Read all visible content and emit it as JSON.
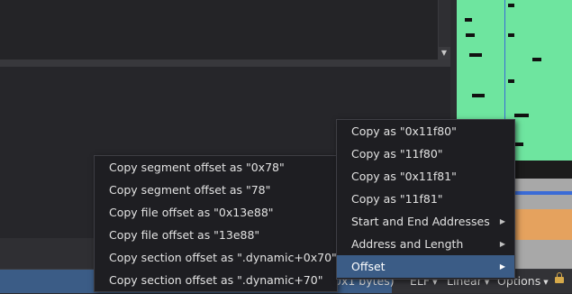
{
  "status": {
    "selection_text": "0x1 bytes)",
    "elf_label": "ELF",
    "linear_label": "Linear",
    "options_label": "Options"
  },
  "menu_main": {
    "items": [
      {
        "label": "Copy as \"0x11f80\"",
        "submenu": false,
        "active": false
      },
      {
        "label": "Copy as \"11f80\"",
        "submenu": false,
        "active": false
      },
      {
        "label": "Copy as \"0x11f81\"",
        "submenu": false,
        "active": false
      },
      {
        "label": "Copy as \"11f81\"",
        "submenu": false,
        "active": false
      },
      {
        "label": "Start and End Addresses",
        "submenu": true,
        "active": false
      },
      {
        "label": "Address and Length",
        "submenu": true,
        "active": false
      },
      {
        "label": "Offset",
        "submenu": true,
        "active": true
      }
    ]
  },
  "menu_offset": {
    "items": [
      {
        "label": "Copy segment offset as \"0x78\""
      },
      {
        "label": "Copy segment offset as \"78\""
      },
      {
        "label": "Copy file offset as \"0x13e88\""
      },
      {
        "label": "Copy file offset as \"13e88\""
      },
      {
        "label": "Copy section offset as \".dynamic+0x70\""
      },
      {
        "label": "Copy section offset as \".dynamic+70\""
      }
    ]
  },
  "colors": {
    "map_green": "#6ee59f",
    "selection_blue": "#3b5c86",
    "menu_bg": "#1e1e22"
  }
}
